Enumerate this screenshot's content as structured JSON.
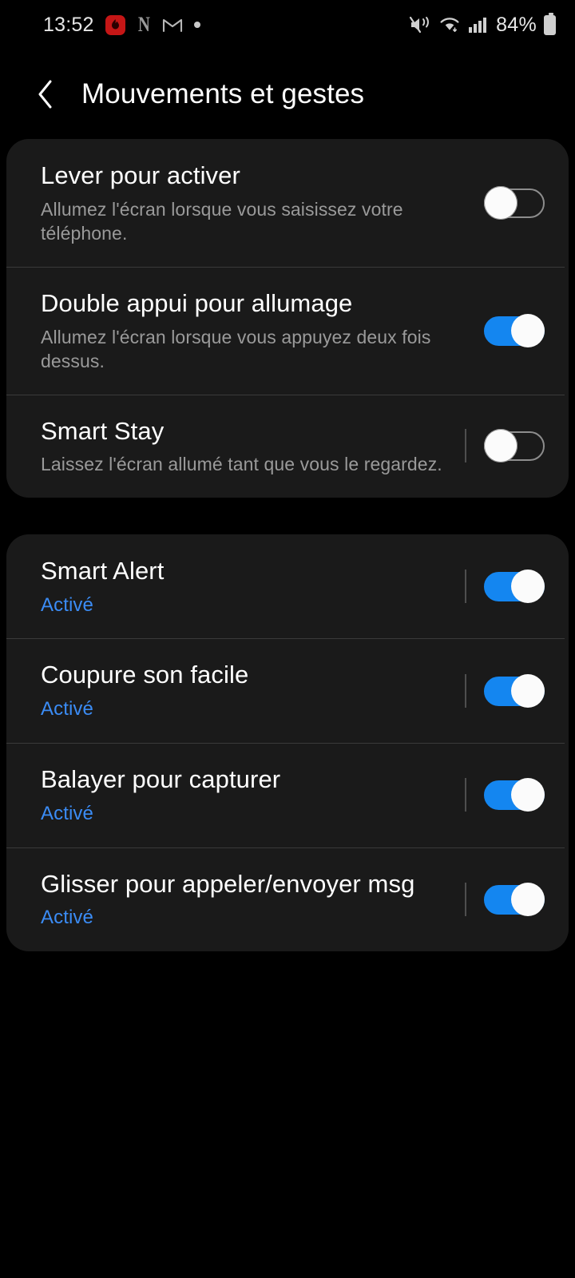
{
  "status_bar": {
    "time": "13:52",
    "left_icons": [
      "app-flame-icon",
      "netflix-icon",
      "gmail-icon",
      "dot-icon"
    ],
    "right_icons": [
      "mute-vibrate-icon",
      "wifi-icon",
      "signal-icon"
    ],
    "battery_percent": "84%"
  },
  "app_bar": {
    "back_icon": "chevron-left-icon",
    "title": "Mouvements et gestes"
  },
  "sections": [
    {
      "rows": [
        {
          "title": "Lever pour activer",
          "subtitle": "Allumez l'écran lorsque vous saisissez votre téléphone.",
          "subtitle_accent": false,
          "toggle": "off",
          "separator": false
        },
        {
          "title": "Double appui pour allumage",
          "subtitle": "Allumez l'écran lorsque vous appuyez deux fois dessus.",
          "subtitle_accent": false,
          "toggle": "on",
          "separator": false
        },
        {
          "title": "Smart Stay",
          "subtitle": "Laissez l'écran allumé tant que vous le regardez.",
          "subtitle_accent": false,
          "toggle": "off",
          "separator": true
        }
      ]
    },
    {
      "rows": [
        {
          "title": "Smart Alert",
          "subtitle": "Activé",
          "subtitle_accent": true,
          "toggle": "on",
          "separator": true
        },
        {
          "title": "Coupure son facile",
          "subtitle": "Activé",
          "subtitle_accent": true,
          "toggle": "on",
          "separator": true
        },
        {
          "title": "Balayer pour capturer",
          "subtitle": "Activé",
          "subtitle_accent": true,
          "toggle": "on",
          "separator": true
        },
        {
          "title": "Glisser pour appeler/envoyer msg",
          "subtitle": "Activé",
          "subtitle_accent": true,
          "toggle": "on",
          "separator": true
        }
      ]
    }
  ],
  "colors": {
    "background": "#000000",
    "card": "#1a1a1a",
    "accent": "#3b8cf5",
    "toggle_on": "#1486f0",
    "title_text": "#ffffff",
    "subtitle_text": "#9a9a9a"
  }
}
